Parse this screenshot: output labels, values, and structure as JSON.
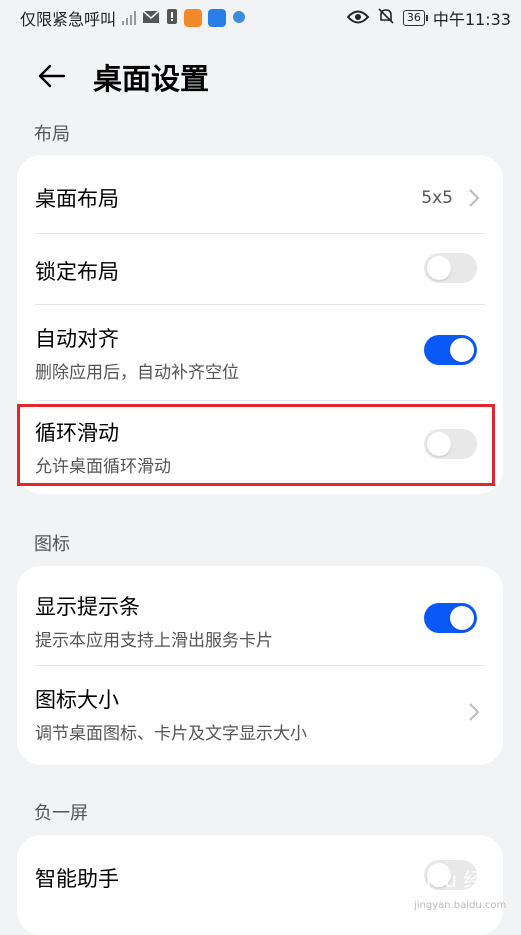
{
  "status_bar": {
    "left_text": "仅限紧急呼叫",
    "time": "中午11:33",
    "battery": "36"
  },
  "header": {
    "title": "桌面设置"
  },
  "sections": [
    {
      "label": "布局",
      "rows": [
        {
          "title": "桌面布局",
          "value": "5x5",
          "control": "chevron"
        },
        {
          "title": "锁定布局",
          "control": "toggle",
          "state": "off"
        },
        {
          "title": "自动对齐",
          "subtitle": "删除应用后，自动补齐空位",
          "control": "toggle",
          "state": "on"
        },
        {
          "title": "循环滑动",
          "subtitle": "允许桌面循环滑动",
          "control": "toggle",
          "state": "off"
        }
      ]
    },
    {
      "label": "图标",
      "rows": [
        {
          "title": "显示提示条",
          "subtitle": "提示本应用支持上滑出服务卡片",
          "control": "toggle",
          "state": "on"
        },
        {
          "title": "图标大小",
          "subtitle": "调节桌面图标、卡片及文字显示大小",
          "control": "chevron"
        }
      ]
    },
    {
      "label": "负一屏",
      "rows": [
        {
          "title": "智能助手",
          "control": "toggle",
          "state": "off"
        }
      ]
    }
  ],
  "watermark": {
    "text": "Baidu 经验",
    "url": "jingyan.baidu.com"
  },
  "colors": {
    "accent": "#0a59f7",
    "highlight": "#e2262b",
    "background": "#f1f3f5"
  }
}
